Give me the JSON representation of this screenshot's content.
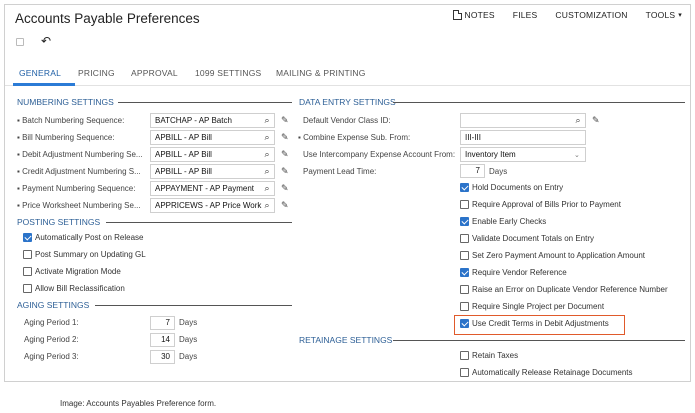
{
  "title": "Accounts Payable Preferences",
  "topnav": {
    "notes": "NOTES",
    "files": "FILES",
    "customization": "CUSTOMIZATION",
    "tools": "TOOLS"
  },
  "tabs": [
    "GENERAL",
    "PRICING",
    "APPROVAL",
    "1099 SETTINGS",
    "MAILING & PRINTING"
  ],
  "numbering": {
    "heading": "NUMBERING SETTINGS",
    "rows": [
      {
        "label": "Batch Numbering Sequence:",
        "value": "BATCHAP - AP Batch"
      },
      {
        "label": "Bill Numbering Sequence:",
        "value": "APBILL - AP Bill"
      },
      {
        "label": "Debit Adjustment Numbering Se...",
        "value": "APBILL - AP Bill"
      },
      {
        "label": "Credit Adjustment Numbering S...",
        "value": "APBILL - AP Bill"
      },
      {
        "label": "Payment Numbering Sequence:",
        "value": "APPAYMENT - AP Payment"
      },
      {
        "label": "Price Worksheet Numbering Se...",
        "value": "APPRICEWS - AP Price Work"
      }
    ]
  },
  "posting": {
    "heading": "POSTING SETTINGS",
    "options": [
      {
        "label": "Automatically Post on Release",
        "checked": true
      },
      {
        "label": "Post Summary on Updating GL",
        "checked": false
      },
      {
        "label": "Activate Migration Mode",
        "checked": false
      },
      {
        "label": "Allow Bill Reclassification",
        "checked": false
      }
    ]
  },
  "aging": {
    "heading": "AGING SETTINGS",
    "rows": [
      {
        "label": "Aging Period 1:",
        "value": "7",
        "unit": "Days"
      },
      {
        "label": "Aging Period 2:",
        "value": "14",
        "unit": "Days"
      },
      {
        "label": "Aging Period 3:",
        "value": "30",
        "unit": "Days"
      }
    ]
  },
  "data_entry": {
    "heading": "DATA ENTRY SETTINGS",
    "default_vendor_class_label": "Default Vendor Class ID:",
    "default_vendor_class_value": "",
    "combine_label": "Combine Expense Sub. From:",
    "combine_value": "III-III",
    "intercompany_label": "Use Intercompany Expense Account From:",
    "intercompany_value": "Inventory Item",
    "lead_time_label": "Payment Lead Time:",
    "lead_time_value": "7",
    "lead_time_unit": "Days",
    "options": [
      {
        "label": "Hold Documents on Entry",
        "checked": true
      },
      {
        "label": "Require Approval of Bills Prior to Payment",
        "checked": false
      },
      {
        "label": "Enable Early Checks",
        "checked": true
      },
      {
        "label": "Validate Document Totals on Entry",
        "checked": false
      },
      {
        "label": "Set Zero Payment Amount to Application Amount",
        "checked": false
      },
      {
        "label": "Require Vendor Reference",
        "checked": true
      },
      {
        "label": "Raise an Error on Duplicate Vendor Reference Number",
        "checked": false
      },
      {
        "label": "Require Single Project per Document",
        "checked": false
      },
      {
        "label": "Use Credit Terms in Debit Adjustments",
        "checked": true
      }
    ]
  },
  "retainage": {
    "heading": "RETAINAGE SETTINGS",
    "options": [
      {
        "label": "Retain Taxes",
        "checked": false
      },
      {
        "label": "Automatically Release Retainage Documents",
        "checked": false
      }
    ]
  },
  "caption": "Image: Accounts Payables Preference form.",
  "colors": {
    "accent": "#2b73c9",
    "section": "#2d5f96",
    "highlight": "#e05a2b"
  }
}
